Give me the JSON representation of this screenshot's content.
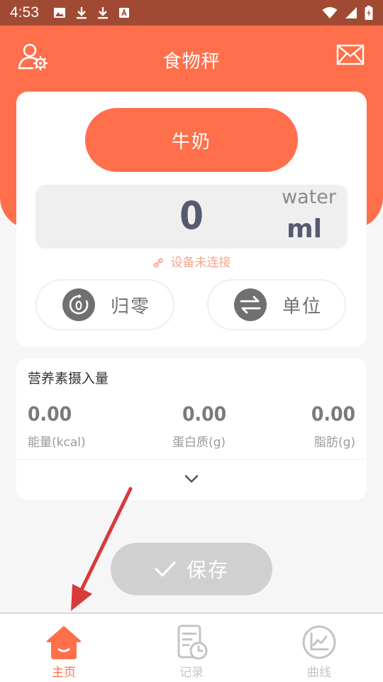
{
  "status_bar": {
    "time": "4:53",
    "icons": [
      "image-icon",
      "download-icon",
      "download-icon",
      "a-icon"
    ],
    "right_icons": [
      "wifi-icon",
      "signal-icon",
      "battery-charging-icon"
    ]
  },
  "header": {
    "title": "食物秤"
  },
  "scale": {
    "food_name": "牛奶",
    "reading": "0",
    "medium": "water",
    "unit": "ml",
    "connection_status": "设备未连接",
    "zero_label": "归零",
    "unit_label": "单位"
  },
  "nutrition": {
    "title": "营养素摄入量",
    "items": [
      {
        "value": "0.00",
        "label": "能量(kcal)"
      },
      {
        "value": "0.00",
        "label": "蛋白质(g)"
      },
      {
        "value": "0.00",
        "label": "脂肪(g)"
      }
    ]
  },
  "save_label": "保存",
  "tabs": [
    {
      "label": "主页",
      "active": true
    },
    {
      "label": "记录",
      "active": false
    },
    {
      "label": "曲线",
      "active": false
    }
  ],
  "colors": {
    "accent": "#ff6f4b",
    "status_bar": "#a14a33",
    "annotation_arrow": "#d83a3a"
  }
}
